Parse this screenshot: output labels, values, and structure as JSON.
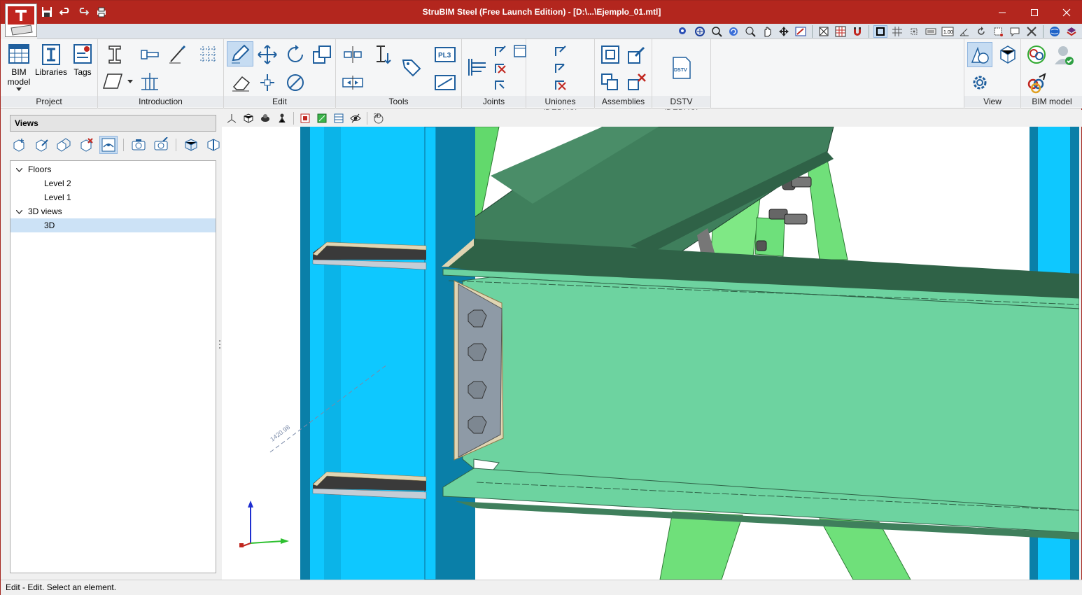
{
  "window": {
    "title": "StruBIM Steel (Free Launch Edition) - [D:\\...\\Ejemplo_01.mtl]"
  },
  "colors": {
    "titlebar": "#b3261e",
    "column_blue": "#0ec8ff",
    "column_blue_dark": "#0a7fa8",
    "beam_green": "#6dd3a0",
    "beam_green_dark": "#3f7f5c",
    "plate_grey": "#8e9aa6",
    "brace_green": "#64e070"
  },
  "quick_access": [
    "save-icon",
    "undo-icon",
    "redo-icon",
    "print-icon"
  ],
  "ribbon": {
    "groups": {
      "project": "Project",
      "introduction": "Introduction",
      "edit": "Edit",
      "tools": "Tools",
      "joints": "Joints",
      "uniones": "Uniones (DEBUG)",
      "assemblies": "Assemblies",
      "dstv": "DSTV (DEBUG)",
      "view": "View",
      "bim_model": "BIM model"
    },
    "buttons": {
      "bim_model": "BIM model",
      "libraries": "Libraries",
      "tags": "Tags",
      "pl3": "PL3",
      "dstv": "DSTV"
    }
  },
  "views_panel": {
    "header": "Views",
    "tree": [
      {
        "label": "Floors",
        "expanded": true
      },
      {
        "label": "Level 2"
      },
      {
        "label": "Level 1"
      },
      {
        "label": "3D views",
        "expanded": true
      },
      {
        "label": "3D",
        "selected": true
      }
    ]
  },
  "viewport": {
    "toolbar_3d_label": "3D",
    "dimension_text": "1420.98"
  },
  "status": {
    "text": "Edit - Edit. Select an element."
  }
}
